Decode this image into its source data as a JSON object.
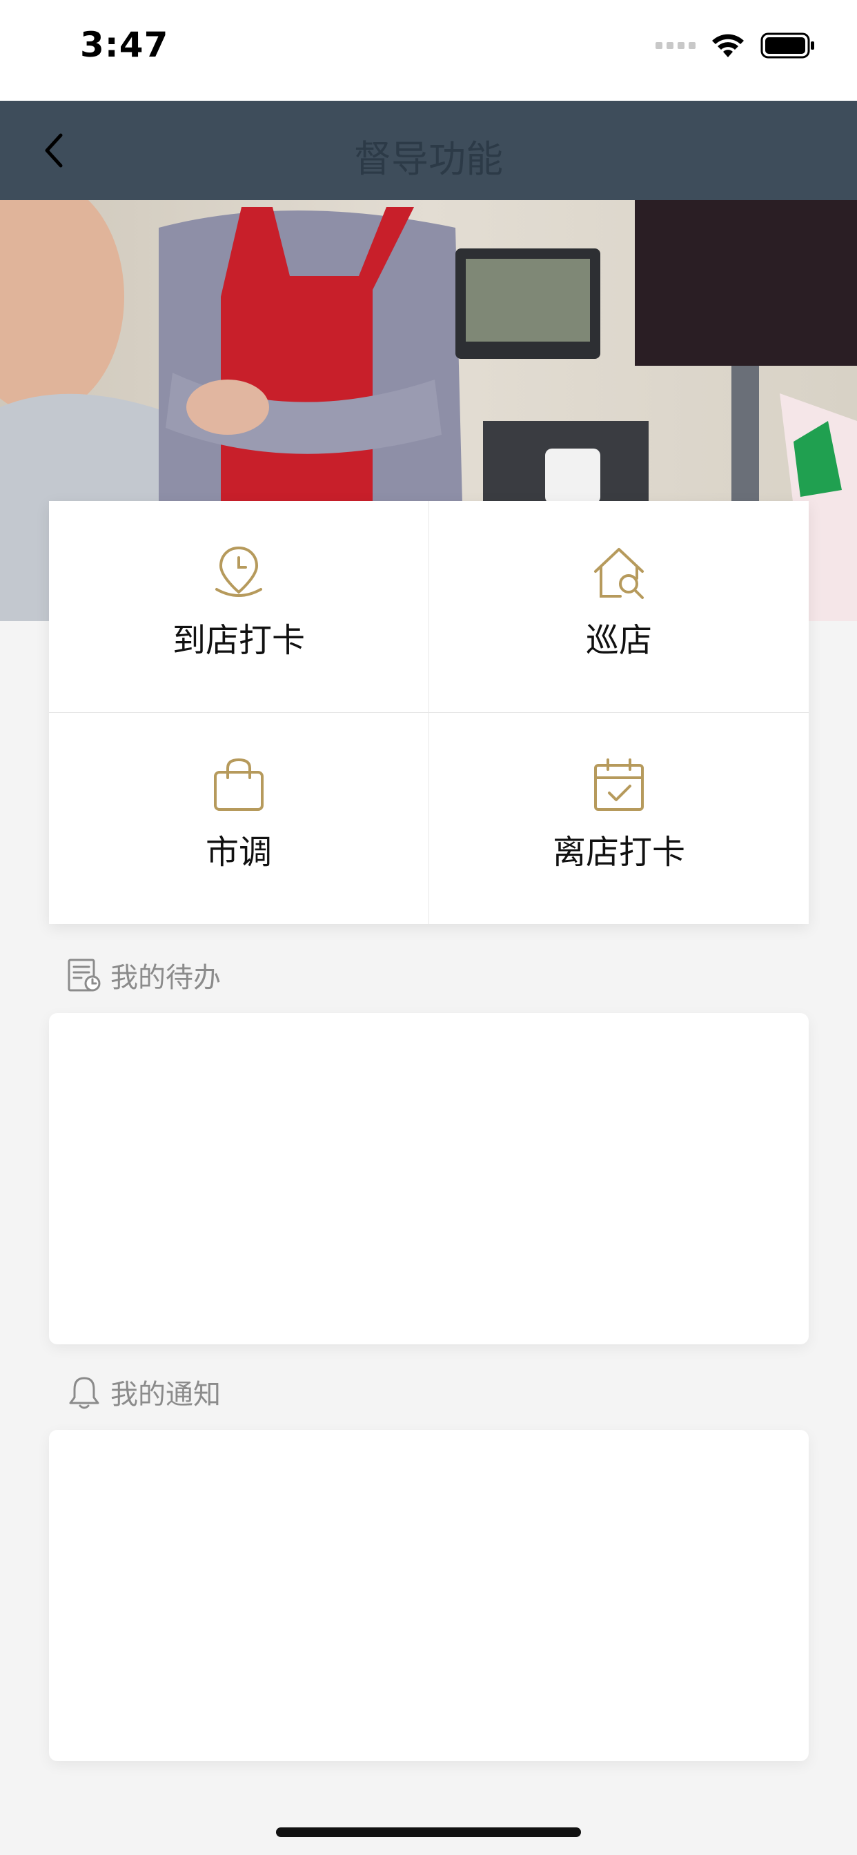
{
  "status_bar": {
    "time": "3:47"
  },
  "nav": {
    "title": "督导功能",
    "back_icon": "chevron-left-icon"
  },
  "banner": {
    "image": "store-clerk-photo"
  },
  "accent_color": "#b69a5c",
  "grid": {
    "items": [
      {
        "label": "到店打卡",
        "icon": "location-clock-icon"
      },
      {
        "label": "巡店",
        "icon": "house-search-icon"
      },
      {
        "label": "市调",
        "icon": "shopping-bag-icon"
      },
      {
        "label": "离店打卡",
        "icon": "calendar-check-icon"
      }
    ]
  },
  "todo": {
    "label": "我的待办",
    "icon": "task-list-icon"
  },
  "notice": {
    "label": "我的通知",
    "icon": "bell-icon"
  }
}
